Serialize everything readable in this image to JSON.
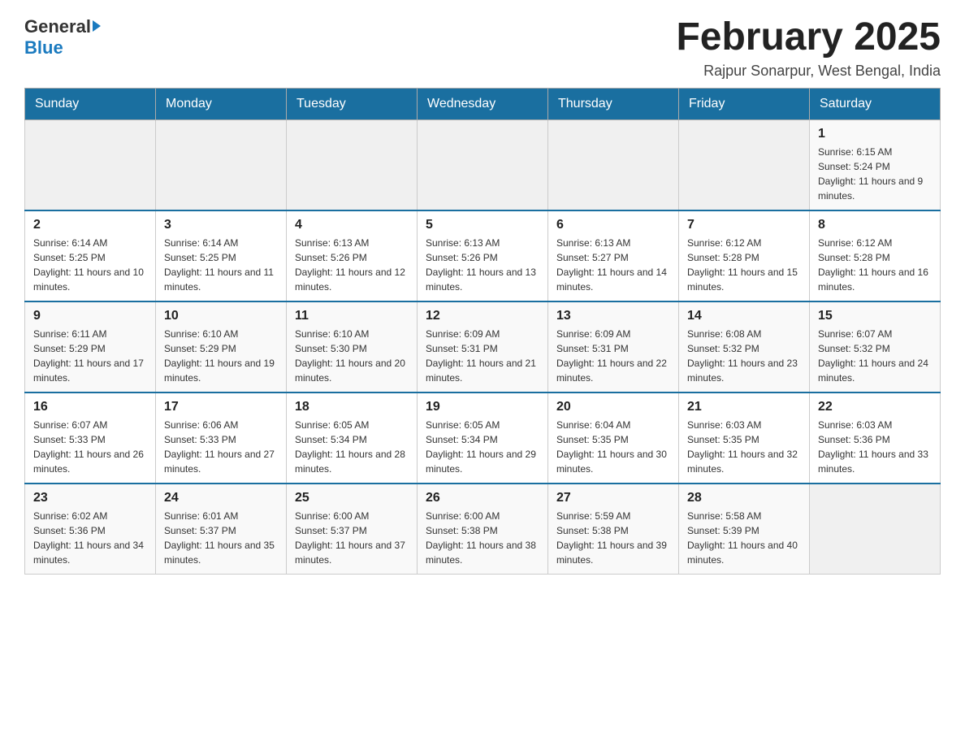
{
  "header": {
    "logo": {
      "general": "General",
      "blue": "Blue"
    },
    "title": "February 2025",
    "subtitle": "Rajpur Sonarpur, West Bengal, India"
  },
  "weekdays": [
    "Sunday",
    "Monday",
    "Tuesday",
    "Wednesday",
    "Thursday",
    "Friday",
    "Saturday"
  ],
  "weeks": [
    [
      {
        "day": "",
        "info": ""
      },
      {
        "day": "",
        "info": ""
      },
      {
        "day": "",
        "info": ""
      },
      {
        "day": "",
        "info": ""
      },
      {
        "day": "",
        "info": ""
      },
      {
        "day": "",
        "info": ""
      },
      {
        "day": "1",
        "info": "Sunrise: 6:15 AM\nSunset: 5:24 PM\nDaylight: 11 hours and 9 minutes."
      }
    ],
    [
      {
        "day": "2",
        "info": "Sunrise: 6:14 AM\nSunset: 5:25 PM\nDaylight: 11 hours and 10 minutes."
      },
      {
        "day": "3",
        "info": "Sunrise: 6:14 AM\nSunset: 5:25 PM\nDaylight: 11 hours and 11 minutes."
      },
      {
        "day": "4",
        "info": "Sunrise: 6:13 AM\nSunset: 5:26 PM\nDaylight: 11 hours and 12 minutes."
      },
      {
        "day": "5",
        "info": "Sunrise: 6:13 AM\nSunset: 5:26 PM\nDaylight: 11 hours and 13 minutes."
      },
      {
        "day": "6",
        "info": "Sunrise: 6:13 AM\nSunset: 5:27 PM\nDaylight: 11 hours and 14 minutes."
      },
      {
        "day": "7",
        "info": "Sunrise: 6:12 AM\nSunset: 5:28 PM\nDaylight: 11 hours and 15 minutes."
      },
      {
        "day": "8",
        "info": "Sunrise: 6:12 AM\nSunset: 5:28 PM\nDaylight: 11 hours and 16 minutes."
      }
    ],
    [
      {
        "day": "9",
        "info": "Sunrise: 6:11 AM\nSunset: 5:29 PM\nDaylight: 11 hours and 17 minutes."
      },
      {
        "day": "10",
        "info": "Sunrise: 6:10 AM\nSunset: 5:29 PM\nDaylight: 11 hours and 19 minutes."
      },
      {
        "day": "11",
        "info": "Sunrise: 6:10 AM\nSunset: 5:30 PM\nDaylight: 11 hours and 20 minutes."
      },
      {
        "day": "12",
        "info": "Sunrise: 6:09 AM\nSunset: 5:31 PM\nDaylight: 11 hours and 21 minutes."
      },
      {
        "day": "13",
        "info": "Sunrise: 6:09 AM\nSunset: 5:31 PM\nDaylight: 11 hours and 22 minutes."
      },
      {
        "day": "14",
        "info": "Sunrise: 6:08 AM\nSunset: 5:32 PM\nDaylight: 11 hours and 23 minutes."
      },
      {
        "day": "15",
        "info": "Sunrise: 6:07 AM\nSunset: 5:32 PM\nDaylight: 11 hours and 24 minutes."
      }
    ],
    [
      {
        "day": "16",
        "info": "Sunrise: 6:07 AM\nSunset: 5:33 PM\nDaylight: 11 hours and 26 minutes."
      },
      {
        "day": "17",
        "info": "Sunrise: 6:06 AM\nSunset: 5:33 PM\nDaylight: 11 hours and 27 minutes."
      },
      {
        "day": "18",
        "info": "Sunrise: 6:05 AM\nSunset: 5:34 PM\nDaylight: 11 hours and 28 minutes."
      },
      {
        "day": "19",
        "info": "Sunrise: 6:05 AM\nSunset: 5:34 PM\nDaylight: 11 hours and 29 minutes."
      },
      {
        "day": "20",
        "info": "Sunrise: 6:04 AM\nSunset: 5:35 PM\nDaylight: 11 hours and 30 minutes."
      },
      {
        "day": "21",
        "info": "Sunrise: 6:03 AM\nSunset: 5:35 PM\nDaylight: 11 hours and 32 minutes."
      },
      {
        "day": "22",
        "info": "Sunrise: 6:03 AM\nSunset: 5:36 PM\nDaylight: 11 hours and 33 minutes."
      }
    ],
    [
      {
        "day": "23",
        "info": "Sunrise: 6:02 AM\nSunset: 5:36 PM\nDaylight: 11 hours and 34 minutes."
      },
      {
        "day": "24",
        "info": "Sunrise: 6:01 AM\nSunset: 5:37 PM\nDaylight: 11 hours and 35 minutes."
      },
      {
        "day": "25",
        "info": "Sunrise: 6:00 AM\nSunset: 5:37 PM\nDaylight: 11 hours and 37 minutes."
      },
      {
        "day": "26",
        "info": "Sunrise: 6:00 AM\nSunset: 5:38 PM\nDaylight: 11 hours and 38 minutes."
      },
      {
        "day": "27",
        "info": "Sunrise: 5:59 AM\nSunset: 5:38 PM\nDaylight: 11 hours and 39 minutes."
      },
      {
        "day": "28",
        "info": "Sunrise: 5:58 AM\nSunset: 5:39 PM\nDaylight: 11 hours and 40 minutes."
      },
      {
        "day": "",
        "info": ""
      }
    ]
  ]
}
